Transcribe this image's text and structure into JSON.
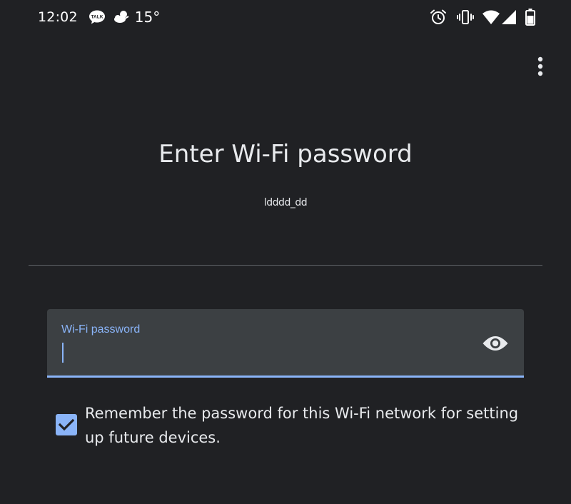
{
  "status_bar": {
    "time": "12:02",
    "temperature": "15°",
    "icons_left": [
      "kakaotalk-icon",
      "weather-icon"
    ],
    "icons_right": [
      "alarm-icon",
      "vibrate-icon",
      "wifi-icon",
      "signal-icon",
      "battery-icon"
    ]
  },
  "header": {
    "menu_icon": "more-vert-icon"
  },
  "main": {
    "title": "Enter Wi-Fi password",
    "network_name": "ldddd_dd"
  },
  "password_field": {
    "label": "Wi-Fi password",
    "value": "",
    "visibility_icon": "eye-icon"
  },
  "remember": {
    "checked": true,
    "label": "Remember the password for this Wi-Fi network for setting up future devices."
  },
  "colors": {
    "background": "#202124",
    "accent": "#8ab4f8",
    "field_background": "#3c4043",
    "text": "#e8eaed",
    "divider": "#5f6368"
  }
}
